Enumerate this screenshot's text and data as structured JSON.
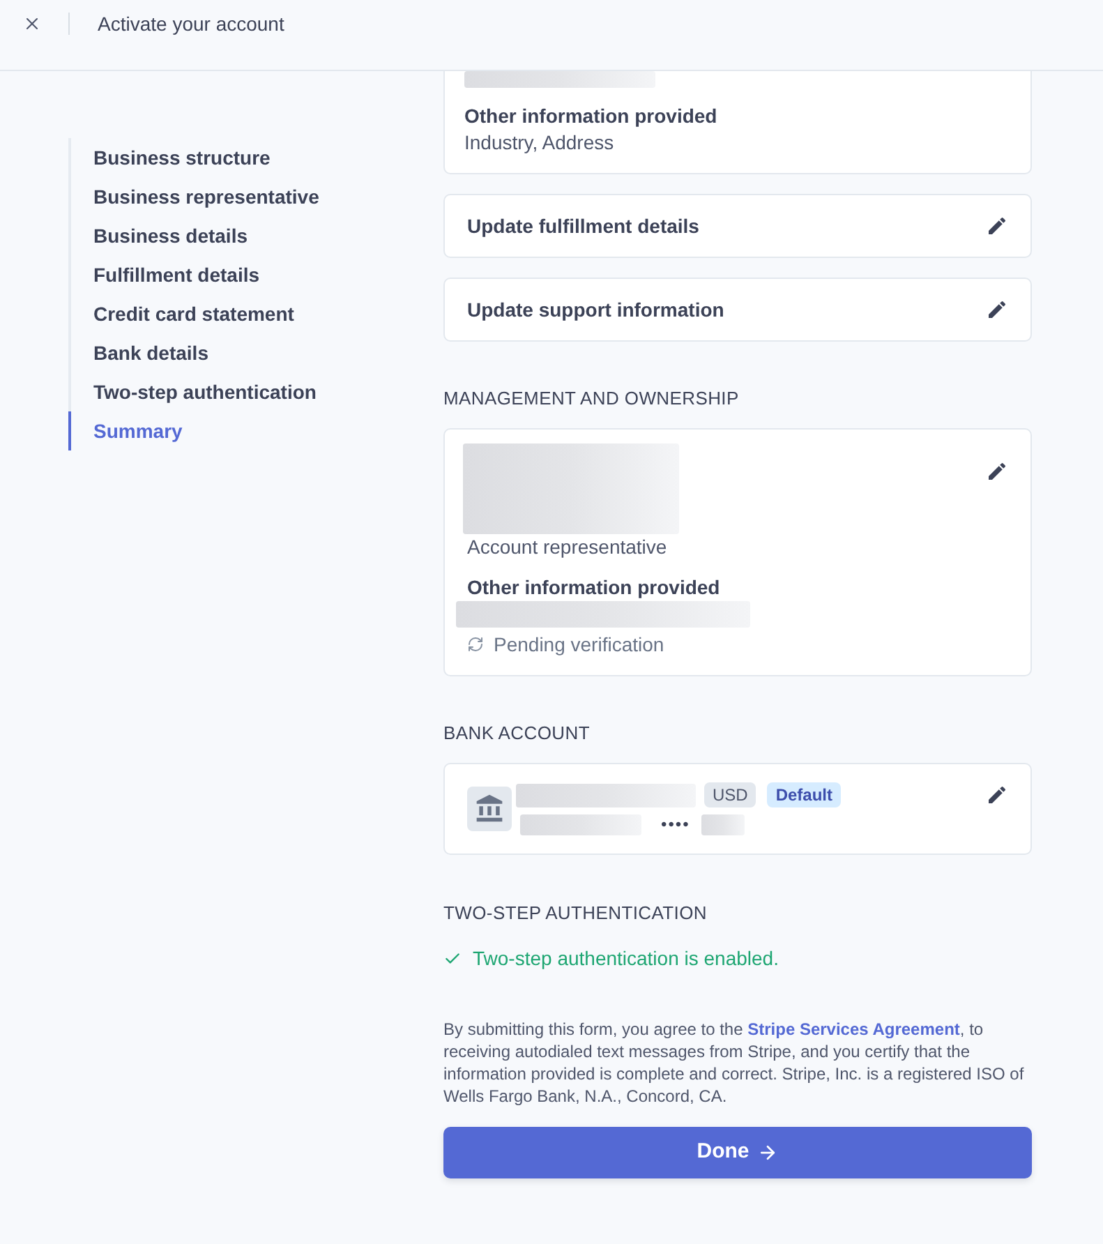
{
  "header": {
    "title": "Activate your account"
  },
  "sidebar": {
    "items": [
      {
        "label": "Business structure",
        "selected": false
      },
      {
        "label": "Business representative",
        "selected": false
      },
      {
        "label": "Business details",
        "selected": false
      },
      {
        "label": "Fulfillment details",
        "selected": false
      },
      {
        "label": "Credit card statement",
        "selected": false
      },
      {
        "label": "Bank details",
        "selected": false
      },
      {
        "label": "Two-step authentication",
        "selected": false
      },
      {
        "label": "Summary",
        "selected": true
      }
    ]
  },
  "business_card": {
    "label": "Other information provided",
    "value": "Industry, Address"
  },
  "update_rows": [
    {
      "label": "Update fulfillment details"
    },
    {
      "label": "Update support information"
    }
  ],
  "management": {
    "heading": "MANAGEMENT AND OWNERSHIP",
    "role": "Account representative",
    "other_label": "Other information provided",
    "status": "Pending verification"
  },
  "bank_account": {
    "heading": "BANK ACCOUNT",
    "currency": "USD",
    "badge": "Default",
    "masked": "••••"
  },
  "two_step": {
    "heading": "TWO-STEP AUTHENTICATION",
    "enabled": true,
    "status": "Two-step authentication is enabled."
  },
  "legal": {
    "before": "By submitting this form, you agree to the ",
    "link": "Stripe Services Agreement",
    "after": ", to receiving autodialed text messages from Stripe, and you certify that the information provided is complete and correct. Stripe, Inc. is a registered ISO of Wells Fargo Bank, N.A., Concord, CA."
  },
  "done_button": {
    "label": "Done"
  }
}
